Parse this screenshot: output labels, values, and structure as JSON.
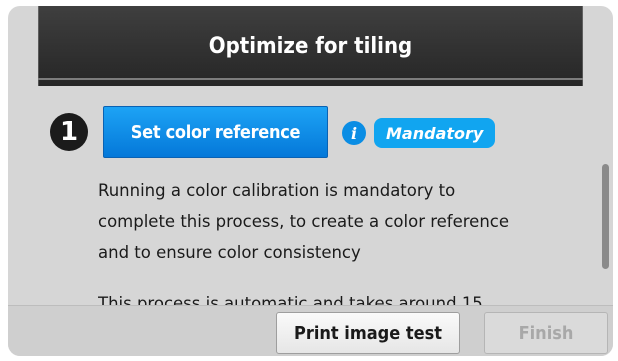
{
  "header": {
    "title": "Optimize for tiling"
  },
  "step": {
    "number": "1",
    "button_label": "Set color reference",
    "info_icon": "i",
    "badge": "Mandatory"
  },
  "description": {
    "lines": [
      "Running a color calibration is mandatory to",
      "complete this process, to create a color reference",
      "and to ensure color consistency"
    ],
    "partial_line": "This process is automatic and takes around 15"
  },
  "footer": {
    "print_label": "Print image test",
    "finish_label": "Finish"
  },
  "colors": {
    "primary": "#0a8de4",
    "header_bg": "#2e2e2e",
    "body_bg": "#d6d6d6"
  }
}
